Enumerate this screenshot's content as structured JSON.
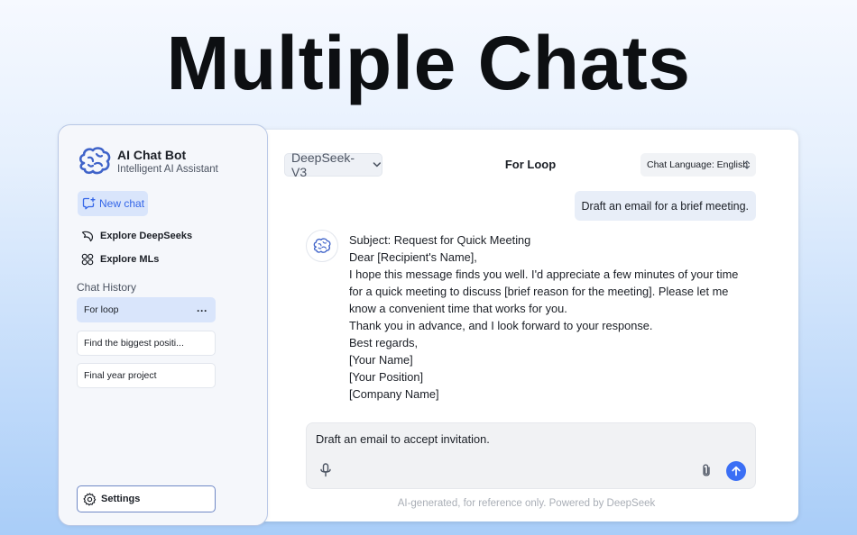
{
  "headline": "Multiple Chats",
  "sidebar": {
    "app_name": "AI Chat Bot",
    "app_subtitle": "Intelligent AI Assistant",
    "new_chat_label": "New chat",
    "nav": [
      {
        "label": "Explore DeepSeeks",
        "icon": "dolphin-icon"
      },
      {
        "label": "Explore MLs",
        "icon": "grid-circles-icon"
      }
    ],
    "history_heading": "Chat History",
    "history": [
      {
        "label": "For loop",
        "active": true,
        "menu": "···"
      },
      {
        "label": "Find the biggest positi...",
        "active": false
      },
      {
        "label": "Final year project",
        "active": false
      }
    ],
    "settings_label": "Settings"
  },
  "chat": {
    "model": "DeepSeek-V3",
    "title": "For Loop",
    "language": "Chat Language: English",
    "user_message": "Draft an email for a brief meeting.",
    "bot_lines": [
      "Subject: Request for Quick Meeting",
      "Dear [Recipient's Name],",
      "I hope this message finds you well. I'd appreciate a few minutes of your time",
      "for a quick meeting to discuss [brief reason for the meeting]. Please let me",
      "know a convenient time that works for you.",
      "Thank you in advance, and I look forward to your response.",
      "Best regards,",
      "[Your Name]",
      "[Your Position]",
      "[Company Name]"
    ],
    "composer_text": "Draft an email to accept invitation.",
    "footer": "AI-generated, for reference only. Powered by DeepSeek"
  },
  "colors": {
    "accent": "#3b6ff5",
    "active_bg": "#d9e5fb"
  }
}
